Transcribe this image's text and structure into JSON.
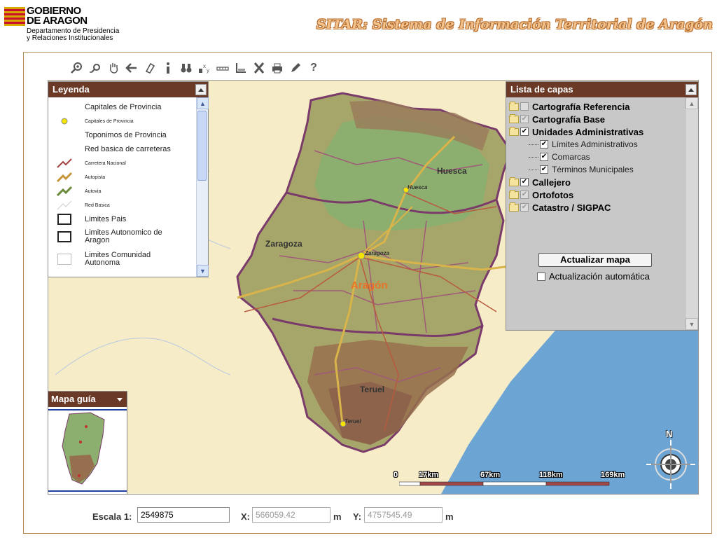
{
  "header": {
    "gov_line1": "GOBIERNO",
    "gov_line2": "DE ARAGON",
    "dept_line1": "Departamento de Presidencia",
    "dept_line2": "y Relaciones Institucionales",
    "app_title": "SITAR: Sistema de Información Territorial de Aragón"
  },
  "toolbar": {
    "tools": [
      "zoom-in-icon",
      "zoom-out-icon",
      "pan-hand-icon",
      "back-arrow-icon",
      "eraser-icon",
      "info-icon",
      "binoculars-icon",
      "xy-coordinate-icon",
      "measure-ruler-icon",
      "area-icon",
      "clear-x-icon",
      "print-icon",
      "pencil-icon",
      "help-icon"
    ],
    "help_label": "?"
  },
  "leyenda": {
    "title": "Leyenda",
    "items": [
      {
        "text": "Capitales de Provincia",
        "size": "lg",
        "icon": "none"
      },
      {
        "text": "Capitales de Provincia",
        "size": "sm",
        "icon": "yellow-dot"
      },
      {
        "text": "Toponimos de Provincia",
        "size": "lg",
        "icon": "none"
      },
      {
        "text": "Red basica de carreteras",
        "size": "lg",
        "icon": "none"
      },
      {
        "text": "Carretera Nacional",
        "size": "sm",
        "icon": "road-national"
      },
      {
        "text": "Autopista",
        "size": "sm",
        "icon": "road-highway"
      },
      {
        "text": "Autovia",
        "size": "sm",
        "icon": "road-autovia"
      },
      {
        "text": "Red Basica",
        "size": "sm",
        "icon": "road-basic"
      },
      {
        "text": "Limites Pais",
        "size": "lg",
        "icon": "box-thick"
      },
      {
        "text": "Limites Autonomico de Aragon",
        "size": "lg",
        "icon": "box-thick"
      },
      {
        "text": "Limites Comunidad Autonoma",
        "size": "lg",
        "icon": "box-thin"
      }
    ]
  },
  "capas": {
    "title": "Lista de capas",
    "layers": [
      {
        "label": "Cartografía Referencia",
        "checked": false,
        "gray": true
      },
      {
        "label": "Cartografía Base",
        "checked": true,
        "gray": true
      },
      {
        "label": "Unidades Administrativas",
        "checked": true,
        "gray": false
      },
      {
        "label": "Límites Administrativos",
        "checked": true,
        "sub": true
      },
      {
        "label": "Comarcas",
        "checked": true,
        "sub": true
      },
      {
        "label": "Términos Municipales",
        "checked": true,
        "sub": true
      },
      {
        "label": "Callejero",
        "checked": true,
        "gray": false
      },
      {
        "label": "Ortofotos",
        "checked": true,
        "gray": true
      },
      {
        "label": "Catastro / SIGPAC",
        "checked": true,
        "gray": true
      }
    ],
    "update_button": "Actualizar mapa",
    "auto_update_label": "Actualización automática",
    "auto_update_checked": false
  },
  "map": {
    "labels": {
      "huesca": "Huesca",
      "huesca_city": "Huesca",
      "zaragoza": "Zaragoza",
      "zaragoza_city": "Zaragoza",
      "aragon": "Aragón",
      "teruel": "Teruel",
      "teruel_city": "Teruel"
    },
    "colors": {
      "land_outside": "#f6ecc8",
      "sea": "#6ca4d4",
      "panel_head": "#6b3a27"
    }
  },
  "guia": {
    "title": "Mapa guía"
  },
  "scalebar": {
    "labels": [
      "0",
      "17km",
      "67km",
      "118km",
      "169km"
    ]
  },
  "compass": {
    "north": "N"
  },
  "bottom": {
    "scale_label": "Escala 1:",
    "scale_value": "2549875",
    "x_label": "X:",
    "x_value": "566059.42",
    "x_unit": "m",
    "y_label": "Y:",
    "y_value": "4757545.49",
    "y_unit": "m"
  }
}
